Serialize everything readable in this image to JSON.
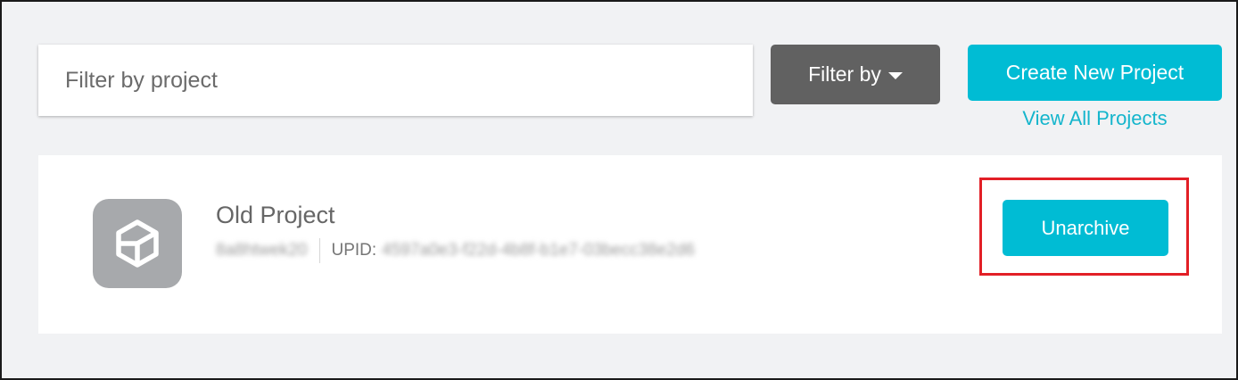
{
  "toolbar": {
    "filter_placeholder": "Filter by project",
    "filter_by_label": "Filter by",
    "create_label": "Create New Project",
    "view_all_label": "View All Projects"
  },
  "project": {
    "name": "Old Project",
    "org_id": "8a8htwek20",
    "upid_label": "UPID:",
    "upid": "4597a0e3-f22d-4b8f-b1e7-03becc38e2d6",
    "icon": "unity-logo-icon",
    "action_label": "Unarchive"
  },
  "colors": {
    "accent": "#00bcd4",
    "link": "#14b5cc",
    "filter_button": "#616161",
    "background": "#f1f2f4",
    "highlight": "#e21f26",
    "avatar": "#a7a9ac"
  }
}
